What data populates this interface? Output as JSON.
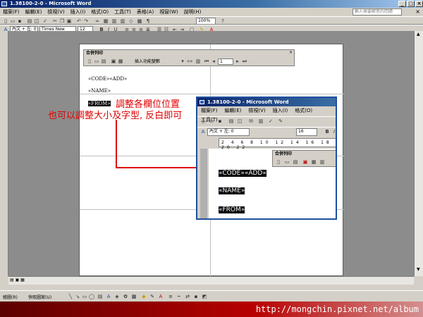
{
  "window": {
    "title": "1.38100-2-0 - Microsoft Word",
    "help_placeholder": "輸入需要解答的問題"
  },
  "menu": [
    "檔案(F)",
    "編輯(E)",
    "檢視(V)",
    "插入(I)",
    "格式(O)",
    "工具(T)",
    "表格(A)",
    "視窗(W)",
    "說明(H)"
  ],
  "toolbar": {
    "zoom": "100%",
    "style": "內文 + 左: 0",
    "font": "Times New Roman",
    "size": "12"
  },
  "mail_merge": {
    "title": "合併列印",
    "insert_field": "插入功能變數",
    "record": "1"
  },
  "fields": {
    "code_add": "«CODE»«ADD»",
    "name": "«NAME»",
    "from": "«FROM»"
  },
  "annotations": {
    "line1": "調整各欄位位置",
    "line2": "也可以調整大小及字型, 反白即可"
  },
  "inset": {
    "title": "1.38100-2-0 - Microsoft Word",
    "menu": [
      "檔案(F)",
      "編輯(E)",
      "檢視(V)",
      "插入(I)",
      "格式(O)",
      "工具(T)"
    ],
    "style": "內文 + 左: 0",
    "size": "16",
    "ruler": "2 4 6 8 10 12 14 16 18 20 22",
    "merge_title": "合併列印",
    "fields": {
      "code_add": "«CODE»«ADD»",
      "name": "«NAME»",
      "from": "«FROM»"
    }
  },
  "drawing_toolbar": {
    "draw": "繪圖(R)",
    "autoshapes": "快取圖案(U)"
  },
  "watermark": "http://mongchin.pixnet.net/album"
}
